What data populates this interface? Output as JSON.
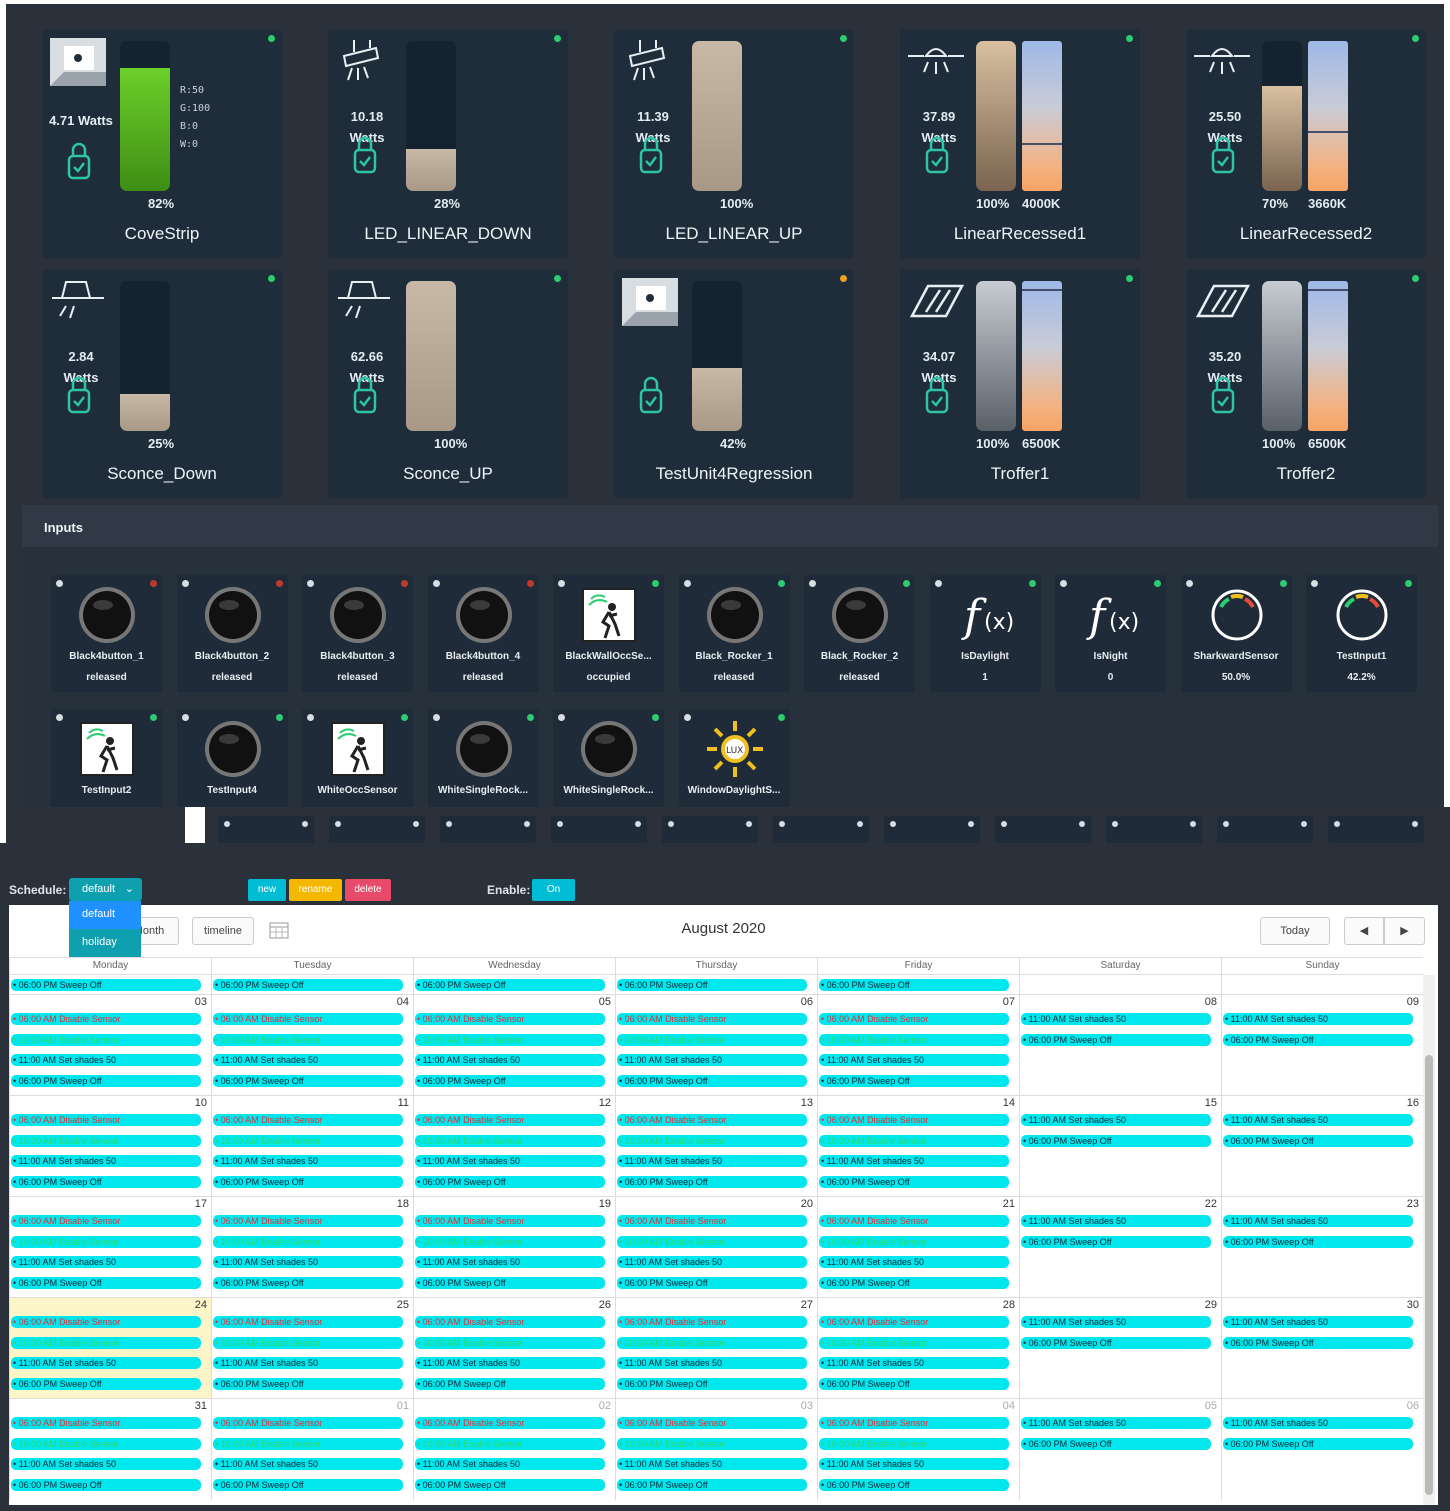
{
  "colors": {
    "panel": "#2a313a",
    "tile": "#1f2d3b",
    "status_ok": "#2ecc71",
    "status_warn": "#f0a020",
    "status_off": "#c0392b",
    "accent": "#00d6e6",
    "event": "#00e8ee"
  },
  "devices": [
    {
      "name": "CoveStrip",
      "watts": "4.71 Watts",
      "level": "82%",
      "level_value": 0.82,
      "rgbw": [
        "R:50",
        "G:100",
        "B:0",
        "W:0"
      ],
      "icon": "cove-strip-icon",
      "type": "rgb",
      "status": "ok"
    },
    {
      "name": "LED_LINEAR_DOWN",
      "watts": "10.18\nWatts",
      "level": "28%",
      "level_value": 0.28,
      "icon": "linear-pendant-icon",
      "type": "dim",
      "status": "ok"
    },
    {
      "name": "LED_LINEAR_UP",
      "watts": "11.39\nWatts",
      "level": "100%",
      "level_value": 1.0,
      "icon": "linear-pendant-icon",
      "type": "dim",
      "status": "ok"
    },
    {
      "name": "LinearRecessed1",
      "watts": "37.89\nWatts",
      "level": "100%",
      "level_value": 1.0,
      "cct": "4000K",
      "cct_value": 0.32,
      "icon": "recessed-light-icon",
      "type": "cct",
      "status": "ok"
    },
    {
      "name": "LinearRecessed2",
      "watts": "25.50\nWatts",
      "level": "70%",
      "level_value": 0.7,
      "cct": "3660K",
      "cct_value": 0.4,
      "icon": "recessed-light-icon",
      "type": "cct",
      "status": "ok"
    },
    {
      "name": "Sconce_Down",
      "watts": "2.84\nWatts",
      "level": "25%",
      "level_value": 0.25,
      "icon": "sconce-icon",
      "type": "dim",
      "status": "ok"
    },
    {
      "name": "Sconce_UP",
      "watts": "62.66\nWatts",
      "level": "100%",
      "level_value": 1.0,
      "icon": "sconce-icon",
      "type": "dim",
      "status": "ok"
    },
    {
      "name": "TestUnit4Regression",
      "watts": "",
      "level": "42%",
      "level_value": 0.42,
      "icon": "cove-strip-icon",
      "type": "dim",
      "status": "warn"
    },
    {
      "name": "Troffer1",
      "watts": "34.07\nWatts",
      "level": "100%",
      "level_value": 1.0,
      "cct": "6500K",
      "cct_value": 0.95,
      "icon": "troffer-icon",
      "type": "cct",
      "status": "ok"
    },
    {
      "name": "Troffer2",
      "watts": "35.20\nWatts",
      "level": "100%",
      "level_value": 1.0,
      "cct": "6500K",
      "cct_value": 0.95,
      "icon": "troffer-icon",
      "type": "cct",
      "status": "ok"
    }
  ],
  "inputs_title": "Inputs",
  "inputs": [
    {
      "name": "Black4button_1",
      "value": "released",
      "icon": "knob-icon",
      "status": "off"
    },
    {
      "name": "Black4button_2",
      "value": "released",
      "icon": "knob-icon",
      "status": "off"
    },
    {
      "name": "Black4button_3",
      "value": "released",
      "icon": "knob-icon",
      "status": "off"
    },
    {
      "name": "Black4button_4",
      "value": "released",
      "icon": "knob-icon",
      "status": "off"
    },
    {
      "name": "BlackWallOccSe...",
      "value": "occupied",
      "icon": "occupancy-sensor-icon",
      "status": "ok"
    },
    {
      "name": "Black_Rocker_1",
      "value": "released",
      "icon": "knob-icon",
      "status": "ok"
    },
    {
      "name": "Black_Rocker_2",
      "value": "released",
      "icon": "knob-icon",
      "status": "ok"
    },
    {
      "name": "IsDaylight",
      "value": "1",
      "icon": "function-icon",
      "status": "ok"
    },
    {
      "name": "IsNight",
      "value": "0",
      "icon": "function-icon",
      "status": "ok"
    },
    {
      "name": "SharkwardSensor",
      "value": "50.0%",
      "icon": "gauge-icon",
      "status": "ok"
    },
    {
      "name": "TestInput1",
      "value": "42.2%",
      "icon": "gauge-icon",
      "status": "ok"
    },
    {
      "name": "TestInput2",
      "value": "",
      "icon": "occupancy-sensor-icon",
      "status": "ok"
    },
    {
      "name": "TestInput4",
      "value": "",
      "icon": "knob-icon",
      "status": "ok"
    },
    {
      "name": "WhiteOccSensor",
      "value": "",
      "icon": "occupancy-sensor-icon",
      "status": "ok"
    },
    {
      "name": "WhiteSingleRock...",
      "value": "",
      "icon": "knob-icon",
      "status": "ok"
    },
    {
      "name": "WhiteSingleRock...",
      "value": "",
      "icon": "knob-icon",
      "status": "ok"
    },
    {
      "name": "WindowDaylightS...",
      "value": "",
      "icon": "lux-sensor-icon",
      "status": "ok"
    }
  ],
  "schedule": {
    "label": "Schedule:",
    "selected": "default",
    "options": [
      "default",
      "holiday"
    ],
    "new_label": "new",
    "rename_label": "rename",
    "delete_label": "delete",
    "enable_label": "Enable:",
    "enable_value": "On",
    "calendar": {
      "title": "August 2020",
      "month_label": "Month",
      "timeline_label": "timeline",
      "today_label": "Today",
      "weekdays": [
        "Monday",
        "Tuesday",
        "Wednesday",
        "Thursday",
        "Friday",
        "Saturday",
        "Sunday"
      ],
      "weekday_events": [
        {
          "text": "06:00 AM Disable Sensor",
          "style": "red"
        },
        {
          "text": "10:00 AM Enable Sensor",
          "style": "grn"
        },
        {
          "text": "11:00 AM Set shades 50",
          "style": "norm"
        },
        {
          "text": "06:00 PM Sweep Off",
          "style": "norm"
        }
      ],
      "weekend_events": [
        {
          "text": "11:00 AM Set shades 50",
          "style": "norm"
        },
        {
          "text": "06:00 PM Sweep Off",
          "style": "norm"
        }
      ],
      "first_row_event": "06:00 PM Sweep Off",
      "weeks": [
        [
          "03",
          "04",
          "05",
          "06",
          "07",
          "08",
          "09"
        ],
        [
          "10",
          "11",
          "12",
          "13",
          "14",
          "15",
          "16"
        ],
        [
          "17",
          "18",
          "19",
          "20",
          "21",
          "22",
          "23"
        ],
        [
          "24",
          "25",
          "26",
          "27",
          "28",
          "29",
          "30"
        ],
        [
          "31",
          "01",
          "02",
          "03",
          "04",
          "05",
          "06"
        ]
      ]
    }
  }
}
